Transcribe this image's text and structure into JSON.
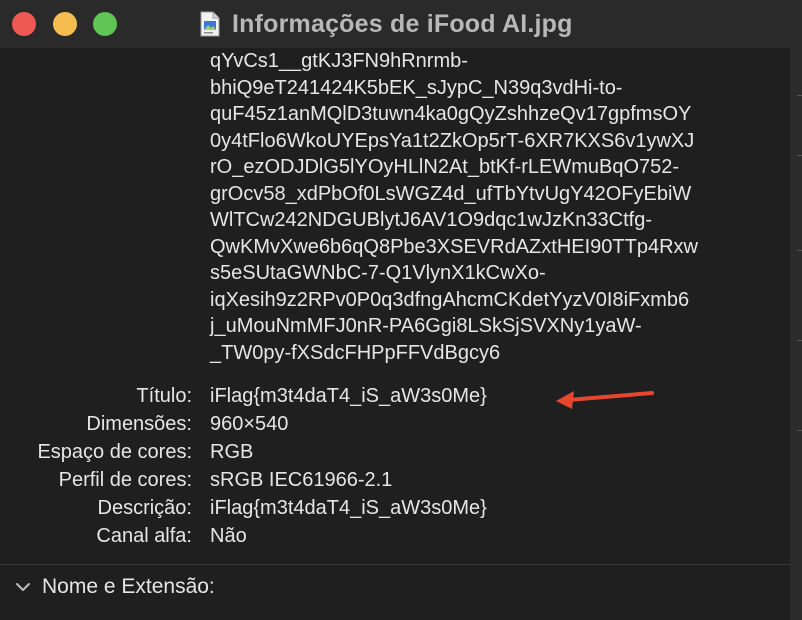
{
  "window": {
    "title": "Informações de iFood AI.jpg"
  },
  "key_lines": [
    "qYvCs1__gtKJ3FN9hRnrmb-",
    "bhiQ9eT241424K5bEK_sJypC_N39q3vdHi-to-",
    "quF45z1anMQlD3tuwn4ka0gQyZshhzeQv17gpfmsOY",
    "0y4tFlo6WkoUYEpsYa1t2ZkOp5rT-6XR7KXS6v1ywXJ",
    "rO_ezODJDlG5lYOyHLlN2At_btKf-rLEWmuBqO752-",
    "grOcv58_xdPbOf0LsWGZ4d_ufTbYtvUgY42OFyEbiW",
    "WlTCw242NDGUBlytJ6AV1O9dqc1wJzKn33Ctfg-",
    "QwKMvXwe6b6qQ8Pbe3XSEVRdAZxtHEI90TTp4Rxw",
    "s5eSUtaGWNbC-7-Q1VlynX1kCwXo-",
    "iqXesih9z2RPv0P0q3dfngAhcmCKdetYyzV0I8iFxmb6",
    "j_uMouNmMFJ0nR-PA6Ggi8LSkSjSVXNy1yaW-",
    "_TW0py-fXSdcFHPpFFVdBgcy6"
  ],
  "info": {
    "titulo_label": "Título:",
    "titulo_value": "iFlag{m3t4daT4_iS_aW3s0Me}",
    "dimensoes_label": "Dimensões:",
    "dimensoes_value": "960×540",
    "espaco_label": "Espaço de cores:",
    "espaco_value": "RGB",
    "perfil_label": "Perfil de cores:",
    "perfil_value": "sRGB IEC61966-2.1",
    "descricao_label": "Descrição:",
    "descricao_value": "iFlag{m3t4daT4_iS_aW3s0Me}",
    "canal_label": "Canal alfa:",
    "canal_value": "Não"
  },
  "section": {
    "label": "Nome e Extensão:"
  },
  "icons": {
    "window_icon": "jpg-document-icon",
    "section_icon": "chevron-down-icon",
    "annotation": "red-arrow-annotation"
  },
  "colors": {
    "close": "#ee5a52",
    "minimize": "#f5bd4f",
    "zoom": "#5fc454",
    "arrow": "#e8462e"
  }
}
